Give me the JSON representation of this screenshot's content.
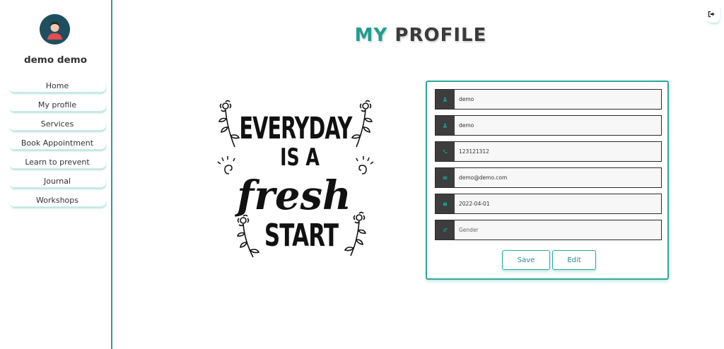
{
  "sidebar": {
    "user_name": "demo demo",
    "items": [
      {
        "label": "Home"
      },
      {
        "label": "My profile"
      },
      {
        "label": "Services"
      },
      {
        "label": "Book Appointment"
      },
      {
        "label": "Learn to prevent"
      },
      {
        "label": "Journal"
      },
      {
        "label": "Workshops"
      }
    ]
  },
  "header": {
    "title_part1": "MY",
    "title_part2": "PROFILE",
    "logout_icon": "sign-out-icon"
  },
  "quote": {
    "line1": "EVERYDAY",
    "line2": "IS A",
    "line3": "fresh",
    "line4": "START"
  },
  "form": {
    "first_name": {
      "value": "demo",
      "icon": "user-icon"
    },
    "last_name": {
      "value": "demo",
      "icon": "user-icon"
    },
    "phone": {
      "value": "123121312",
      "icon": "phone-icon"
    },
    "email": {
      "value": "demo@demo.com",
      "icon": "envelope-icon"
    },
    "dob": {
      "value": "2022-04-01",
      "icon": "calendar-icon"
    },
    "gender": {
      "value": "",
      "placeholder": "Gender",
      "icon": "gender-icon"
    },
    "save_label": "Save",
    "edit_label": "Edit"
  },
  "colors": {
    "accent": "#1e9e90",
    "dark": "#3d3d3d",
    "avatar_bg": "#1f4f5f"
  }
}
